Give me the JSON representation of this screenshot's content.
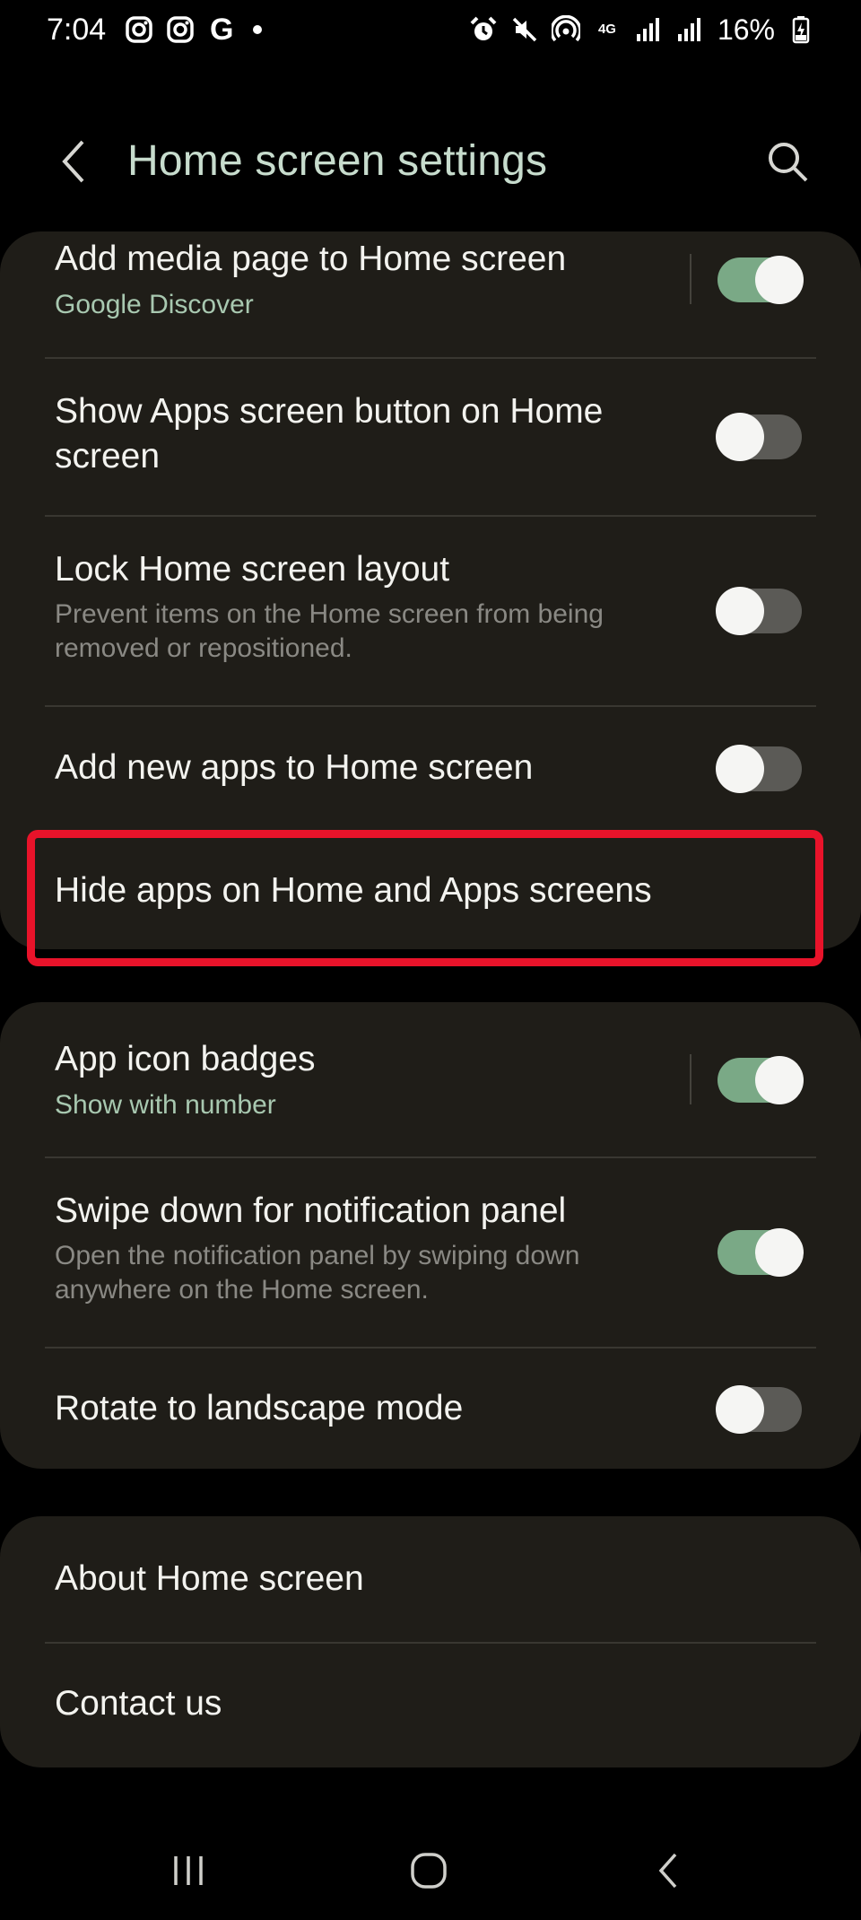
{
  "status_bar": {
    "time": "7:04",
    "left_icons": [
      "instagram-icon",
      "instagram-icon",
      "google-icon",
      "dot-icon"
    ],
    "g_letter": "G",
    "network_label": "4G",
    "right_icons": [
      "alarm-icon",
      "mute-icon",
      "hotspot-icon",
      "signal-icon",
      "signal-icon",
      "battery-charging-icon"
    ],
    "battery": "16%"
  },
  "header": {
    "title": "Home screen settings",
    "back_icon": "chevron-left-icon",
    "search_icon": "search-icon"
  },
  "groups": [
    {
      "items": [
        {
          "title": "Add media page to Home screen",
          "subtitle": "Google Discover",
          "toggle": "on"
        },
        {
          "title": "Show Apps screen button on Home screen",
          "toggle": "off"
        },
        {
          "title": "Lock Home screen layout",
          "subtitle": "Prevent items on the Home screen from being removed or repositioned.",
          "toggle": "off"
        },
        {
          "title": "Add new apps to Home screen",
          "toggle": "off"
        },
        {
          "title": "Hide apps on Home and Apps screens"
        }
      ]
    },
    {
      "items": [
        {
          "title": "App icon badges",
          "subtitle": "Show with number",
          "toggle": "on"
        },
        {
          "title": "Swipe down for notification panel",
          "subtitle": "Open the notification panel by swiping down anywhere on the Home screen.",
          "toggle": "on"
        },
        {
          "title": "Rotate to landscape mode",
          "toggle": "off"
        }
      ]
    },
    {
      "items": [
        {
          "title": "About Home screen"
        },
        {
          "title": "Contact us"
        }
      ]
    }
  ],
  "highlight_color": "#e8132a",
  "accent_color": "#7aa986",
  "nav_bar": [
    "recent-apps-icon",
    "home-icon",
    "back-icon"
  ]
}
